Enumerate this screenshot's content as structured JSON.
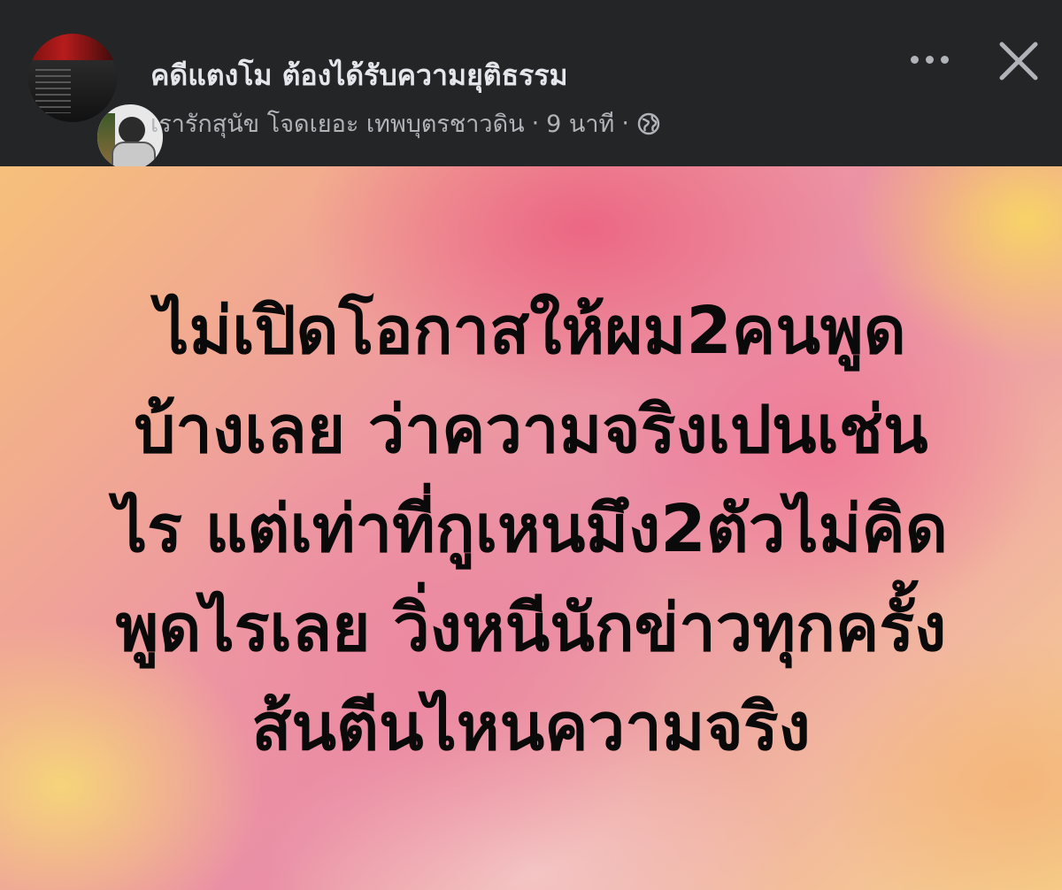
{
  "header": {
    "page_name": "คดีแตงโม ต้องได้รับความยุติธรรม",
    "author_meta": "เรารักสุนัข โจดเยอะ เทพบุตรชาวดิน",
    "separator": "·",
    "time_ago": "9 นาที",
    "privacy_icon": "globe-icon",
    "more_icon": "more-horizontal-icon",
    "close_icon": "close-icon"
  },
  "post": {
    "lines": [
      "ไม่เปิดโอกาสให้ผม2คนพูด",
      "บ้างเลย ว่าความจริงเปนเช่น",
      "ไร แต่เท่าที่กูเหนมึง2ตัวไม่คิด",
      "พูดไรเลย วิ่งหนีนักข่าวทุกครั้ง",
      "ส้นตีนไหนความจริง"
    ]
  },
  "colors": {
    "header_bg": "#242526",
    "title_text": "#e4e6eb",
    "meta_text": "#b0b3b8",
    "post_text": "#0a0a0a"
  }
}
